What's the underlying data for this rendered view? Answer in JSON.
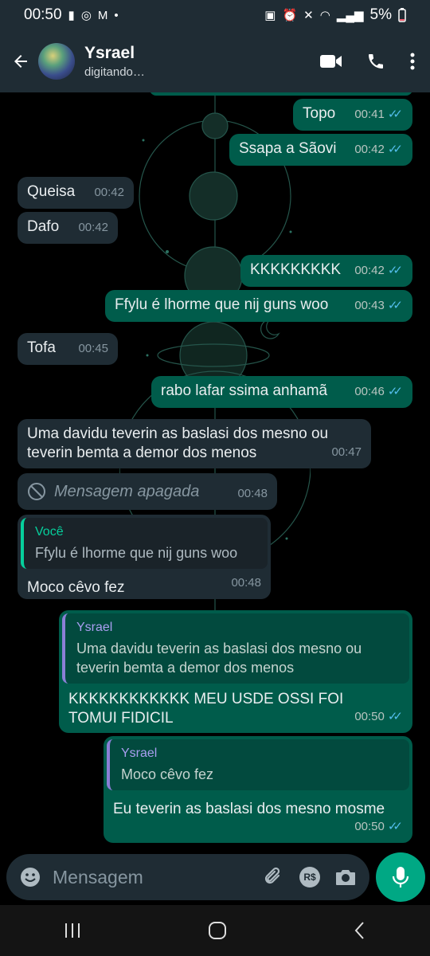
{
  "status_bar": {
    "time": "00:50",
    "battery": "5%"
  },
  "header": {
    "contact_name": "Ysrael",
    "status": "digitando…"
  },
  "messages": [
    {
      "dir": "out",
      "text": "Topo",
      "time": "00:41"
    },
    {
      "dir": "out",
      "text": "Ssapa a Sãovi",
      "time": "00:42"
    },
    {
      "dir": "in",
      "text": "Queisa",
      "time": "00:42"
    },
    {
      "dir": "in",
      "text": "Dafo",
      "time": "00:42"
    },
    {
      "dir": "out",
      "text": "KKKKKKKKK",
      "time": "00:42"
    },
    {
      "dir": "out",
      "text": "Ffylu é lhorme que nij guns woo",
      "time": "00:43"
    },
    {
      "dir": "in",
      "text": "Tofa",
      "time": "00:45"
    },
    {
      "dir": "out",
      "text": "rabo lafar ssima anhamã",
      "time": "00:46"
    },
    {
      "dir": "in",
      "text": "Uma davidu teverin as baslasi dos mesno ou teverin bemta a demor dos menos",
      "time": "00:47"
    },
    {
      "dir": "in",
      "text": "Mensagem apagada",
      "time": "00:48"
    },
    {
      "dir": "in",
      "quote_author": "Você",
      "quote_text": "Ffylu é lhorme que nij guns woo",
      "text": "Moco cêvo fez",
      "time": "00:48"
    },
    {
      "dir": "out",
      "quote_author": "Ysrael",
      "quote_text": "Uma davidu teverin as baslasi dos mesno ou teverin bemta a demor dos menos",
      "text": "KKKKKKKKKKKK MEU USDE OSSI FOI TOMUI FIDICIL",
      "time": "00:50"
    },
    {
      "dir": "out",
      "quote_author": "Ysrael",
      "quote_text": "Moco cêvo fez",
      "text": "Eu teverin as baslasi dos mesno mosme",
      "time": "00:50"
    }
  ],
  "composer": {
    "placeholder": "Mensagem",
    "currency_label": "R$"
  },
  "colors": {
    "outgoing_bubble": "#005c4b",
    "incoming_bubble": "#1f2c34",
    "accent": "#00a884",
    "read_ticks": "#53bdeb"
  }
}
